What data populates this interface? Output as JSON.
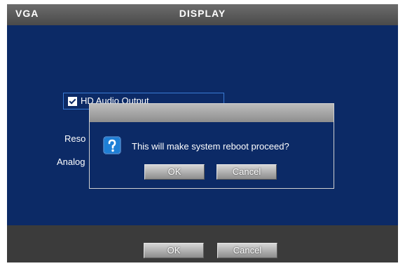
{
  "window": {
    "left_label": "VGA",
    "title": "DISPLAY"
  },
  "background_form": {
    "checkbox_label": "HD Audio Output",
    "checkbox_checked": true,
    "resolution_label_partial": "Reso",
    "analog_label_partial": "Analog"
  },
  "dialog": {
    "message": "This will make system reboot proceed?",
    "ok_label": "OK",
    "cancel_label": "Cancel",
    "icon": "question-icon"
  },
  "footer": {
    "ok_label": "OK",
    "cancel_label": "Cancel"
  },
  "colors": {
    "panel": "#0c2a66",
    "frame": "#3a3a3a",
    "button": "#a8a8a8",
    "accent_border": "#3a7bd5"
  }
}
